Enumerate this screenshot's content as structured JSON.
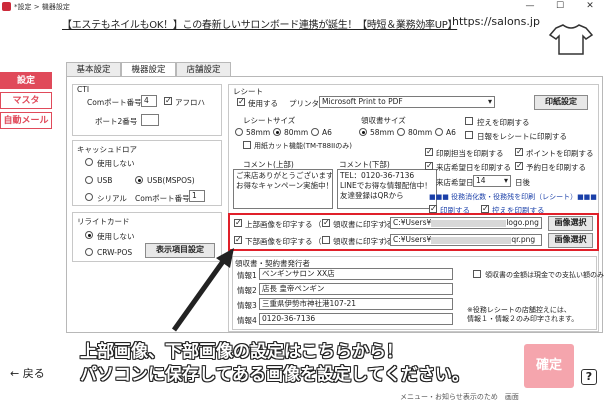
{
  "window": {
    "title": "*設定 > 機器設定",
    "minimize": "—",
    "maximize": "☐",
    "close": "✕"
  },
  "banner": {
    "text": "【エステもネイルもOK！】この春新しいサロンボード連携が誕生！【時短＆業務効率UP】",
    "url": "https://salons.jp"
  },
  "sidebar": {
    "items": [
      "設定",
      "マスタ",
      "自動メール"
    ],
    "active": 0
  },
  "tabs": [
    "基本設定",
    "機器設定",
    "店舗設定"
  ],
  "cti": {
    "title": "CTI",
    "com_label": "Comポート番号",
    "com_value": "4",
    "afloha_label": "アフロハ",
    "port2_label": "ポート2番号",
    "port2_value": ""
  },
  "cashdrawer": {
    "title": "キャッシュドロア",
    "options": [
      "使用しない",
      "USB",
      "USB(MSPOS)",
      "シリアル"
    ],
    "selected": "USB(MSPOS)",
    "com_label": "Comポート番号",
    "com_value": "1"
  },
  "relight": {
    "title": "リライトカード",
    "options": [
      "使用しない",
      "CRW-POS"
    ],
    "selected": "使用しない",
    "button": "表示項目設定"
  },
  "receipt": {
    "title": "レシート",
    "use_label": "使用する",
    "printer_label": "プリンタ名",
    "printer_value": "Microsoft Print to PDF",
    "print_settings_button": "印紙設定",
    "copy_label": "控えを印刷する",
    "date_label": "日報をレシートに印刷する",
    "size_title": "レシートサイズ",
    "size_options": [
      "58mm",
      "80mm",
      "A6"
    ],
    "size_selected": "80mm",
    "dedicated_label": "用紙カット機能(TM-T88IIのみ)",
    "receipt_size_title": "領収書サイズ",
    "receipt_size_options": [
      "58mm",
      "80mm",
      "A6"
    ],
    "receipt_size_selected": "80mm",
    "comment_top_label": "コメント(上部)",
    "comment_top_text": "ご来店ありがとうございます☆\nお得なキャンペーン実施中！",
    "comment_bottom_label": "コメント(下部)",
    "comment_bottom_text": "TEL：0120-36-7136\nLINEでお得な情報配信中！\n友達登録はQRから",
    "staff_label": "印刷担当を印刷する",
    "point_label": "ポイントを印刷する",
    "next_label": "来店希望日を印刷する",
    "reserve_label": "予約日を印刷する",
    "visit_label": "来店希望日",
    "visit_value": "14",
    "visit_unit": "日後",
    "tax_title": "■■■ 役務消化数・役務残を印刷（レシート）■■■",
    "tax_print_label": "印刷する",
    "tax_copy_label": "控えを印刷する"
  },
  "image_rows": [
    {
      "label": "上部画像を印字する",
      "sub_label": "領収書に印字する",
      "path_prefix": "C:¥Users¥",
      "path_file": "logo.png",
      "button": "画像選択"
    },
    {
      "label": "下部画像を印字する",
      "sub_label": "領収書に印字する",
      "path_prefix": "C:¥Users¥",
      "path_file": "qr.png",
      "button": "画像選択"
    }
  ],
  "issuer": {
    "title": "領収書・契約書発行者",
    "rows": [
      {
        "label": "情報1",
        "value": "ベンギンサロン  XX店"
      },
      {
        "label": "情報2",
        "value": "店長  皇帝ペンギン"
      },
      {
        "label": "情報3",
        "value": "三重県伊勢市神社港107-21"
      },
      {
        "label": "情報4",
        "value": "0120-36-7136"
      }
    ],
    "cash_label": "領収書の金額は現金での支払い額のみ",
    "note": "※役務レシートの店舗控えには、\n情報１・情報２のみ印字されます。"
  },
  "annotation": {
    "line1": "上部画像、下部画像の設定はこちらから！",
    "line2": "パソコンに保存してある画像を設定してください。"
  },
  "footer": {
    "back": "← 戻る",
    "confirm": "確定",
    "help": "?",
    "bottom_text": "メニュー・お知らせ表示のため　画面"
  }
}
